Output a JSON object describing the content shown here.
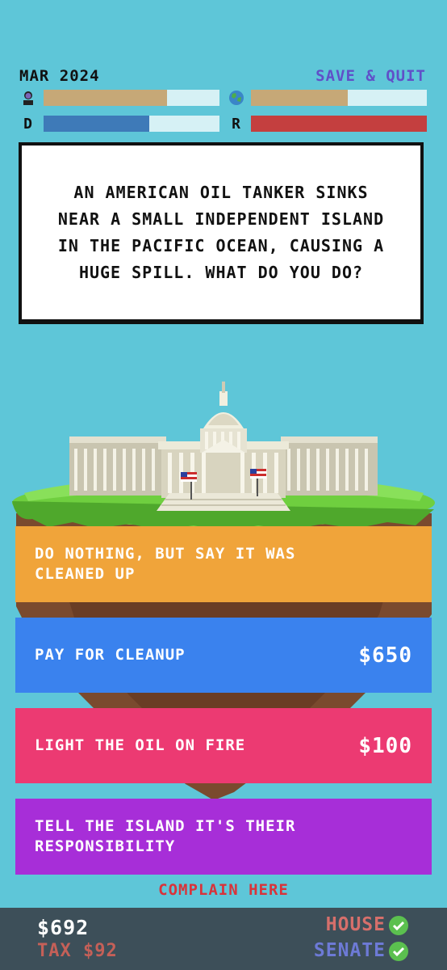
{
  "hud": {
    "date": "MAR 2024",
    "save_quit_label": "SAVE & QUIT",
    "meters": {
      "people": {
        "icon": "person-icon",
        "fill_fraction": 0.7,
        "color": "#c6a877"
      },
      "planet": {
        "icon": "globe-icon",
        "fill_fraction": 0.55,
        "color": "#c6a877"
      },
      "democrat": {
        "label": "D",
        "fill_fraction": 0.6,
        "color": "#3e7ab8"
      },
      "republican": {
        "label": "R",
        "fill_fraction": 1.0,
        "color": "#c43f3f"
      }
    }
  },
  "question": {
    "text": "AN AMERICAN OIL TANKER SINKS NEAR A SMALL INDEPENDENT ISLAND IN THE PACIFIC OCEAN, CAUSING A HUGE SPILL. WHAT DO YOU DO?"
  },
  "choices": [
    {
      "label": "DO NOTHING, BUT SAY IT WAS CLEANED UP",
      "cost": "",
      "color": "#f0a43a"
    },
    {
      "label": "PAY FOR CLEANUP",
      "cost": "$650",
      "color": "#3a82ee"
    },
    {
      "label": "LIGHT THE OIL ON FIRE",
      "cost": "$100",
      "color": "#ec3a72"
    },
    {
      "label": "TELL THE ISLAND IT'S THEIR RESPONSIBILITY",
      "cost": "",
      "color": "#a72ed8"
    }
  ],
  "complain_label": "COMPLAIN HERE",
  "status": {
    "money": "$692",
    "tax": "TAX $92",
    "house_label": "HOUSE",
    "senate_label": "SENATE"
  },
  "colors": {
    "background": "#5ec6d8",
    "bottom_bar": "#3d4f59",
    "save_quit": "#6050c8",
    "complain": "#d8333a",
    "check": "#5bc04f"
  }
}
